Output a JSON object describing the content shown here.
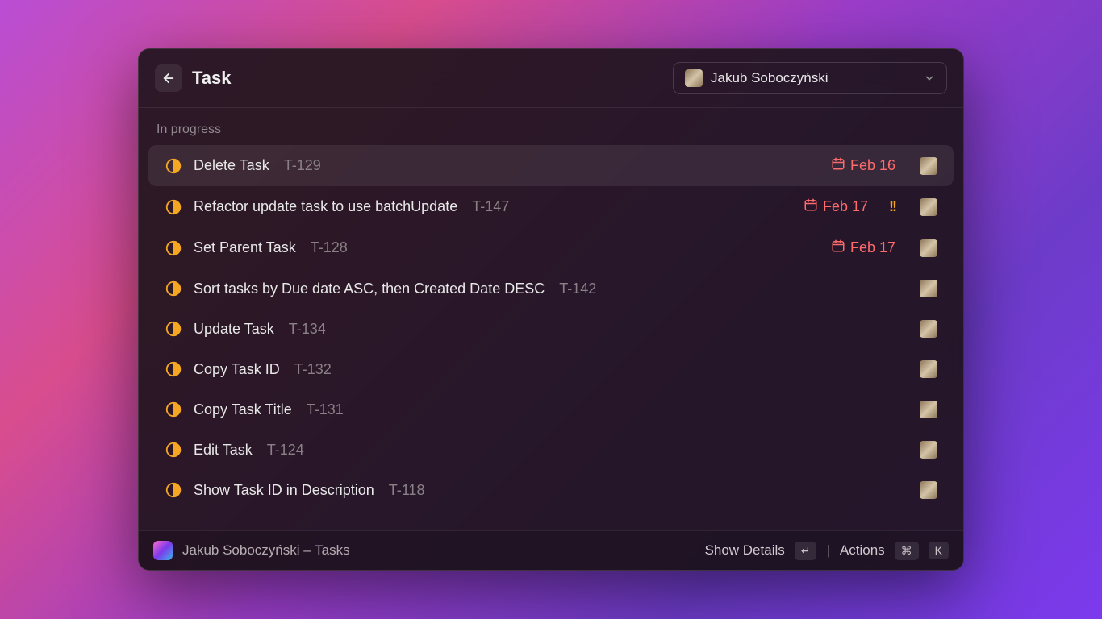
{
  "header": {
    "title": "Task",
    "user": "Jakub Soboczyński"
  },
  "section": {
    "label": "In progress"
  },
  "tasks": [
    {
      "title": "Delete Task",
      "id": "T-129",
      "due": "Feb 16",
      "priority": false,
      "selected": true
    },
    {
      "title": "Refactor update task to use batchUpdate",
      "id": "T-147",
      "due": "Feb 17",
      "priority": true,
      "selected": false
    },
    {
      "title": "Set Parent Task",
      "id": "T-128",
      "due": "Feb 17",
      "priority": false,
      "selected": false
    },
    {
      "title": "Sort tasks by Due date ASC, then Created Date DESC",
      "id": "T-142",
      "due": "",
      "priority": false,
      "selected": false
    },
    {
      "title": "Update Task",
      "id": "T-134",
      "due": "",
      "priority": false,
      "selected": false
    },
    {
      "title": "Copy Task ID",
      "id": "T-132",
      "due": "",
      "priority": false,
      "selected": false
    },
    {
      "title": "Copy Task Title",
      "id": "T-131",
      "due": "",
      "priority": false,
      "selected": false
    },
    {
      "title": "Edit Task",
      "id": "T-124",
      "due": "",
      "priority": false,
      "selected": false
    },
    {
      "title": "Show Task ID in Description",
      "id": "T-118",
      "due": "",
      "priority": false,
      "selected": false
    }
  ],
  "footer": {
    "extension": "Jakub Soboczyński – Tasks",
    "show_details": "Show Details",
    "actions": "Actions",
    "enter_key": "↵",
    "cmd_key": "⌘",
    "k_key": "K"
  },
  "priority_glyph": "!!"
}
